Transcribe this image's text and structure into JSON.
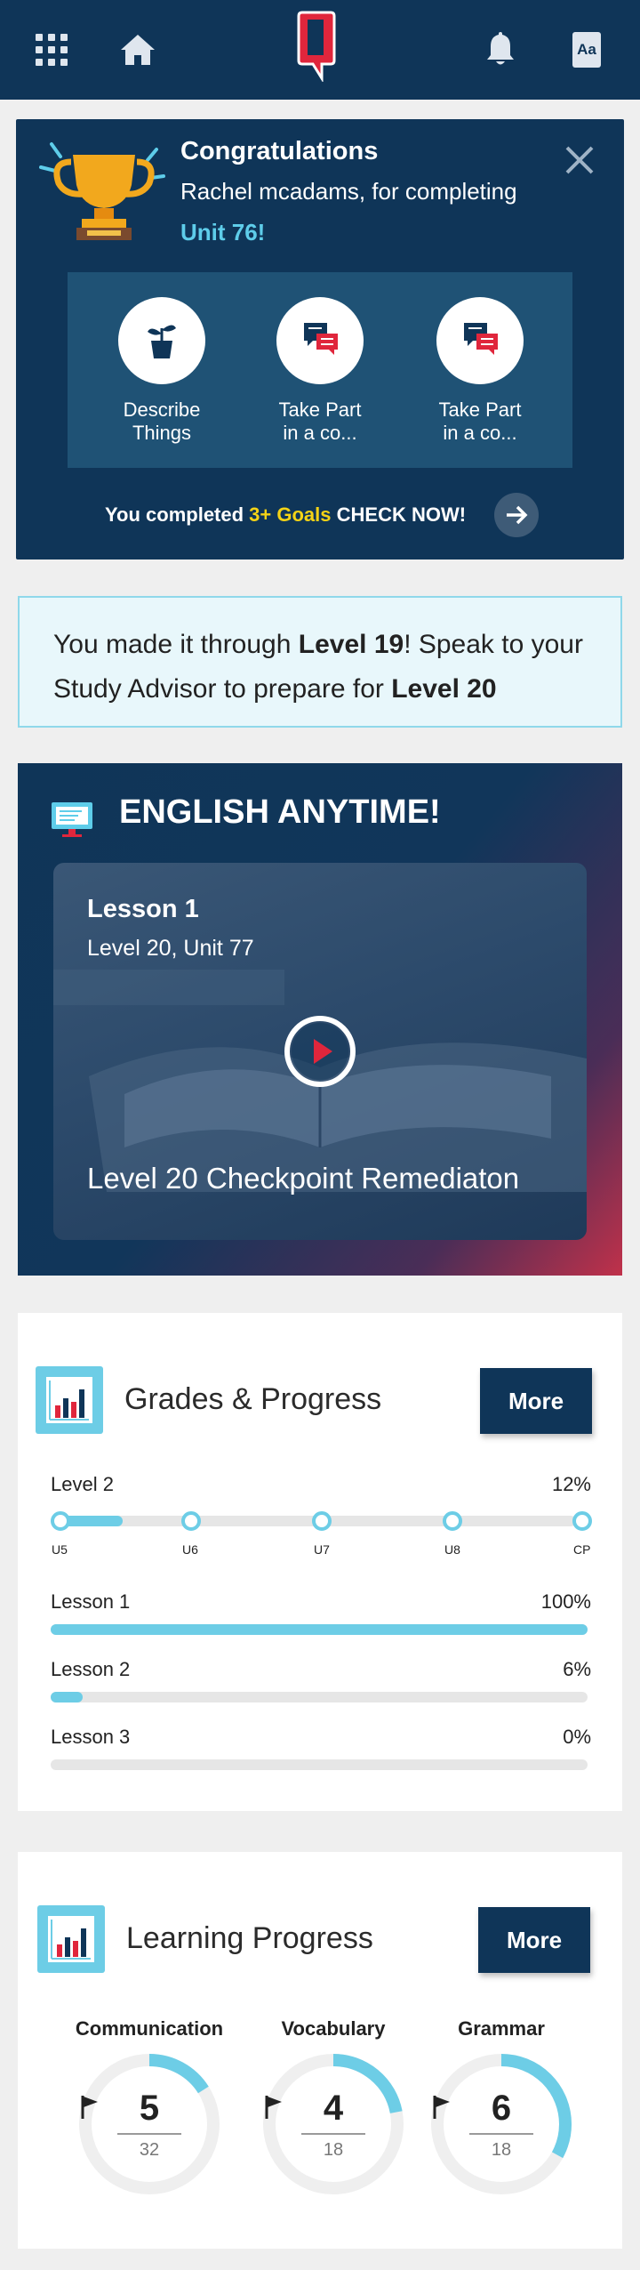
{
  "header": {
    "apps_icon": "grid-icon",
    "home_icon": "home-icon",
    "logo": "speech-bubble-logo",
    "bell_icon": "bell-icon",
    "font_button_label": "Aa"
  },
  "congrats": {
    "title": "Congratulations",
    "subtitle": "Rachel mcadams, for completing",
    "unit": "Unit 76!",
    "goals": [
      {
        "line1": "Describe",
        "line2": "Things",
        "icon": "plant-icon"
      },
      {
        "line1": "Take Part",
        "line2": "in a co...",
        "icon": "chat-icon"
      },
      {
        "line1": "Take Part",
        "line2": "in a co...",
        "icon": "chat-icon"
      }
    ],
    "footer_prefix": "You completed ",
    "footer_highlight": "3+ Goals",
    "footer_suffix": " CHECK NOW!"
  },
  "level_banner": {
    "part1": "You made it through ",
    "level_from": "Level 19",
    "part2": "! Speak to your Study Advisor to prepare for ",
    "level_to": "Level 20"
  },
  "anytime": {
    "title": "ENGLISH ANYTIME!",
    "lesson_title": "Lesson 1",
    "lesson_sub": "Level 20, Unit 77",
    "caption": "Level 20 Checkpoint Remediaton"
  },
  "grades": {
    "title": "Grades & Progress",
    "more_label": "More",
    "level_label": "Level 2",
    "level_value": "12%",
    "level_progress": 0.12,
    "units": [
      "U5",
      "U6",
      "U7",
      "U8",
      "CP"
    ],
    "lessons": [
      {
        "label": "Lesson 1",
        "value": "100%",
        "progress": 1.0
      },
      {
        "label": "Lesson 2",
        "value": "6%",
        "progress": 0.06
      },
      {
        "label": "Lesson 3",
        "value": "0%",
        "progress": 0.0
      }
    ]
  },
  "learning": {
    "title": "Learning Progress",
    "more_label": "More",
    "skills": [
      {
        "name": "Communication",
        "value": "5",
        "total": "32",
        "fraction": 0.16
      },
      {
        "name": "Vocabulary",
        "value": "4",
        "total": "18",
        "fraction": 0.22
      },
      {
        "name": "Grammar",
        "value": "6",
        "total": "18",
        "fraction": 0.33
      }
    ]
  },
  "colors": {
    "navy": "#0f3558",
    "accent_cyan": "#6dcde6",
    "highlight_yellow": "#f4d316",
    "brand_red": "#e0263c"
  }
}
